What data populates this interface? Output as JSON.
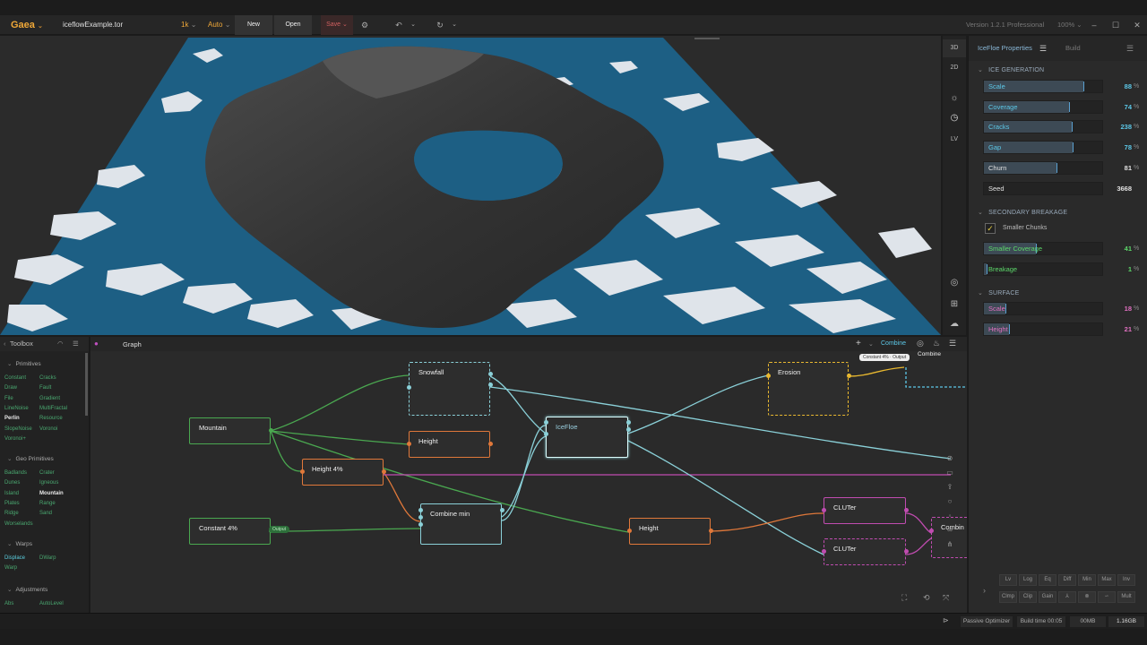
{
  "titlebar": {
    "app": "Gaea",
    "file": "iceflowExample.tor",
    "resolution": "1k",
    "mode": "Auto",
    "new": "New",
    "open": "Open",
    "save": "Save",
    "version": "Version 1.2.1 Professional",
    "zoom": "100%"
  },
  "viewport_tools": {
    "three_d": "3D",
    "two_d": "2D",
    "lv": "LV"
  },
  "properties": {
    "tab_active": "IceFloe Properties",
    "tab_build": "Build",
    "sections": [
      {
        "title": "ICE GENERATION"
      },
      {
        "title": "SECONDARY BREAKAGE"
      },
      {
        "title": "SURFACE"
      }
    ],
    "ice": [
      {
        "label": "Scale",
        "value": "88",
        "unit": "%",
        "fraction": 0.84,
        "color": "#5cc8e8"
      },
      {
        "label": "Coverage",
        "value": "74",
        "unit": "%",
        "fraction": 0.72,
        "color": "#5cc8e8"
      },
      {
        "label": "Cracks",
        "value": "238",
        "unit": "%",
        "fraction": 0.74,
        "color": "#5cc8e8"
      },
      {
        "label": "Gap",
        "value": "78",
        "unit": "%",
        "fraction": 0.75,
        "color": "#5cc8e8"
      },
      {
        "label": "Churn",
        "value": "81",
        "unit": "%",
        "fraction": 0.61,
        "color": "#e0e0e0"
      },
      {
        "label": "Seed",
        "value": "3668",
        "unit": "",
        "fraction": 0.0,
        "color": "#e0e0e0"
      }
    ],
    "secondary": {
      "checkbox_label": "Smaller Chunks",
      "checked": true,
      "sliders": [
        {
          "label": "Smaller Coverage",
          "value": "41",
          "unit": "%",
          "fraction": 0.44,
          "color": "#5cd86a"
        },
        {
          "label": "Breakage",
          "value": "1",
          "unit": "%",
          "fraction": 0.02,
          "color": "#5cd86a"
        }
      ]
    },
    "surface": [
      {
        "label": "Scale",
        "value": "18",
        "unit": "%",
        "fraction": 0.18,
        "color": "#e070c0"
      },
      {
        "label": "Height",
        "value": "21",
        "unit": "%",
        "fraction": 0.21,
        "color": "#e070c0"
      }
    ],
    "bottom_row1": [
      "Lv",
      "Log",
      "Eq",
      "Diff",
      "Min",
      "Max",
      "Inv"
    ],
    "bottom_row2": [
      "Clmp",
      "Clip",
      "Gain",
      "",
      "",
      "",
      "Mult"
    ]
  },
  "toolbox": {
    "title": "Toolbox",
    "sections": [
      {
        "title": "Primitives",
        "items": [
          "Constant",
          "Cracks",
          "Draw",
          "Fault",
          "File",
          "Gradient",
          "LineNoise",
          "MultiFractal",
          "Perlin",
          "Resource",
          "SlopeNoise",
          "Voronoi",
          "Voronoi+"
        ]
      },
      {
        "title": "Geo Primitives",
        "items": [
          "Badlands",
          "Crater",
          "Dunes",
          "Igneous",
          "Island",
          "Mountain",
          "Plates",
          "Range",
          "Ridge",
          "Sand",
          "Worselands"
        ]
      },
      {
        "title": "Warps",
        "items": [
          "Displace",
          "DWarp",
          "Warp"
        ]
      },
      {
        "title": "Adjustments",
        "items": [
          "Abs",
          "AutoLevel"
        ]
      }
    ]
  },
  "graph": {
    "title": "Graph",
    "combine_label": "Combine",
    "tooltip": "Constant 4% · Output",
    "output_label": "Output",
    "nodes": {
      "mountain": "Mountain",
      "snowfall": "Snowfall",
      "height1": "Height",
      "height4": "Height 4%",
      "constant4": "Constant 4%",
      "combinemin": "Combine min",
      "icefloe": "IceFloe",
      "erosion": "Erosion",
      "combine_top": "Combine",
      "height2": "Height",
      "cluter1": "CLUTer",
      "cluter2": "CLUTer",
      "combine_right": "Combin"
    }
  },
  "status": {
    "optimizer": "Passive Optimizer",
    "build_time": "Build time 00:05",
    "mem": "00MB",
    "mem2": "1.16GB"
  }
}
